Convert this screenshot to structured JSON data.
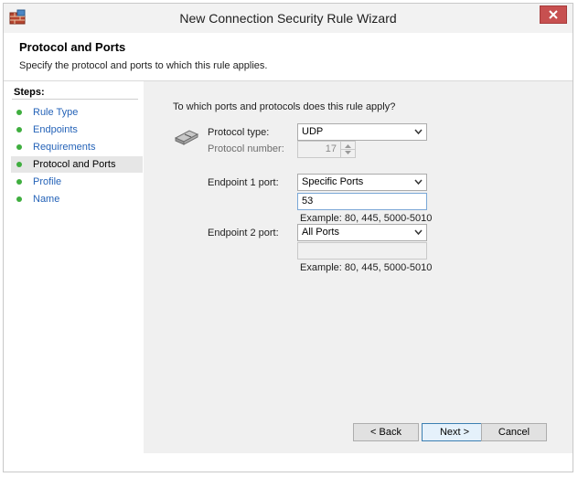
{
  "window": {
    "title": "New Connection Security Rule Wizard"
  },
  "header": {
    "title": "Protocol and Ports",
    "subtitle": "Specify the protocol and ports to which this rule applies."
  },
  "steps": {
    "label": "Steps:",
    "items": [
      {
        "label": "Rule Type",
        "active": false
      },
      {
        "label": "Endpoints",
        "active": false
      },
      {
        "label": "Requirements",
        "active": false
      },
      {
        "label": "Protocol and Ports",
        "active": true
      },
      {
        "label": "Profile",
        "active": false
      },
      {
        "label": "Name",
        "active": false
      }
    ]
  },
  "form": {
    "question": "To which ports and protocols does this rule apply?",
    "protocol_type_label": "Protocol type:",
    "protocol_type_value": "UDP",
    "protocol_number_label": "Protocol number:",
    "protocol_number_value": "17",
    "endpoint1_label": "Endpoint 1 port:",
    "endpoint1_select": "Specific Ports",
    "endpoint1_input": "53",
    "endpoint1_example": "Example: 80, 445, 5000-5010",
    "endpoint2_label": "Endpoint 2 port:",
    "endpoint2_select": "All Ports",
    "endpoint2_input": "",
    "endpoint2_example": "Example: 80, 445, 5000-5010"
  },
  "buttons": {
    "back": "< Back",
    "next": "Next >",
    "cancel": "Cancel"
  },
  "colors": {
    "close_button": "#c75050",
    "step_bullet": "#3fae3f",
    "link": "#2563b8",
    "content_bg": "#f0f0f0"
  }
}
